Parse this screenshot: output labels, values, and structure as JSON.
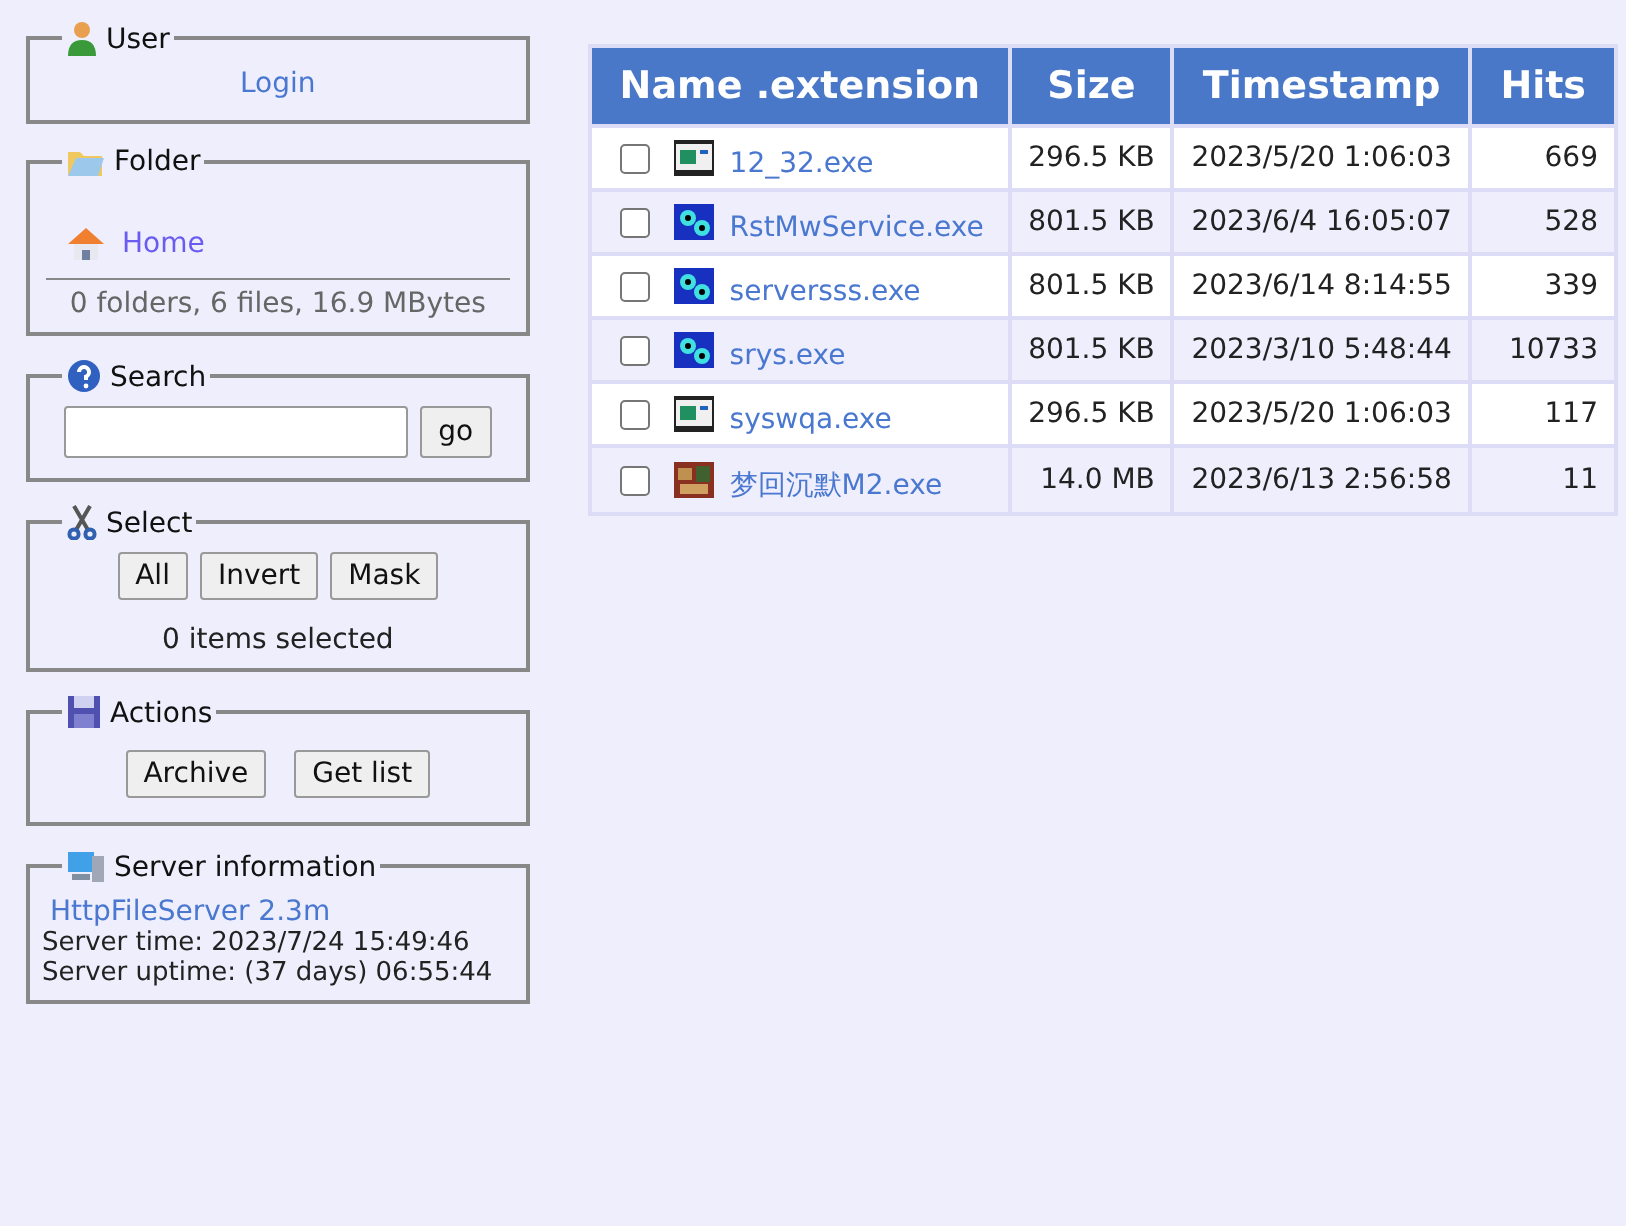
{
  "user": {
    "legend": "User",
    "login": "Login"
  },
  "folder": {
    "legend": "Folder",
    "home": "Home",
    "summary": "0 folders, 6 files, 16.9 MBytes"
  },
  "search": {
    "legend": "Search",
    "button": "go"
  },
  "select": {
    "legend": "Select",
    "buttons": [
      "All",
      "Invert",
      "Mask"
    ],
    "status": "0 items selected"
  },
  "actions": {
    "legend": "Actions",
    "buttons": [
      "Archive",
      "Get list"
    ]
  },
  "server": {
    "legend": "Server information",
    "link": "HttpFileServer 2.3m",
    "lines": [
      "Server time: 2023/7/24 15:49:46",
      "Server uptime: (37 days) 06:55:44"
    ]
  },
  "table": {
    "columns": [
      "Name .extension",
      "Size",
      "Timestamp",
      "Hits"
    ],
    "rows": [
      {
        "kind": "window",
        "name": "12_32.exe",
        "size": "296.5 KB",
        "timestamp": "2023/5/20 1:06:03",
        "hits": "669",
        "checked": false
      },
      {
        "kind": "service",
        "name": "RstMwService.exe",
        "size": "801.5 KB",
        "timestamp": "2023/6/4 16:05:07",
        "hits": "528",
        "checked": false
      },
      {
        "kind": "service",
        "name": "serversss.exe",
        "size": "801.5 KB",
        "timestamp": "2023/6/14 8:14:55",
        "hits": "339",
        "checked": false
      },
      {
        "kind": "service",
        "name": "srys.exe",
        "size": "801.5 KB",
        "timestamp": "2023/3/10 5:48:44",
        "hits": "10733",
        "checked": false
      },
      {
        "kind": "window",
        "name": "syswqa.exe",
        "size": "296.5 KB",
        "timestamp": "2023/5/20 1:06:03",
        "hits": "117",
        "checked": false
      },
      {
        "name": "梦回沉默M2.exe",
        "size": "14.0 MB",
        "timestamp": "2023/6/13 2:56:58",
        "hits": "11",
        "checked": false
      }
    ]
  }
}
